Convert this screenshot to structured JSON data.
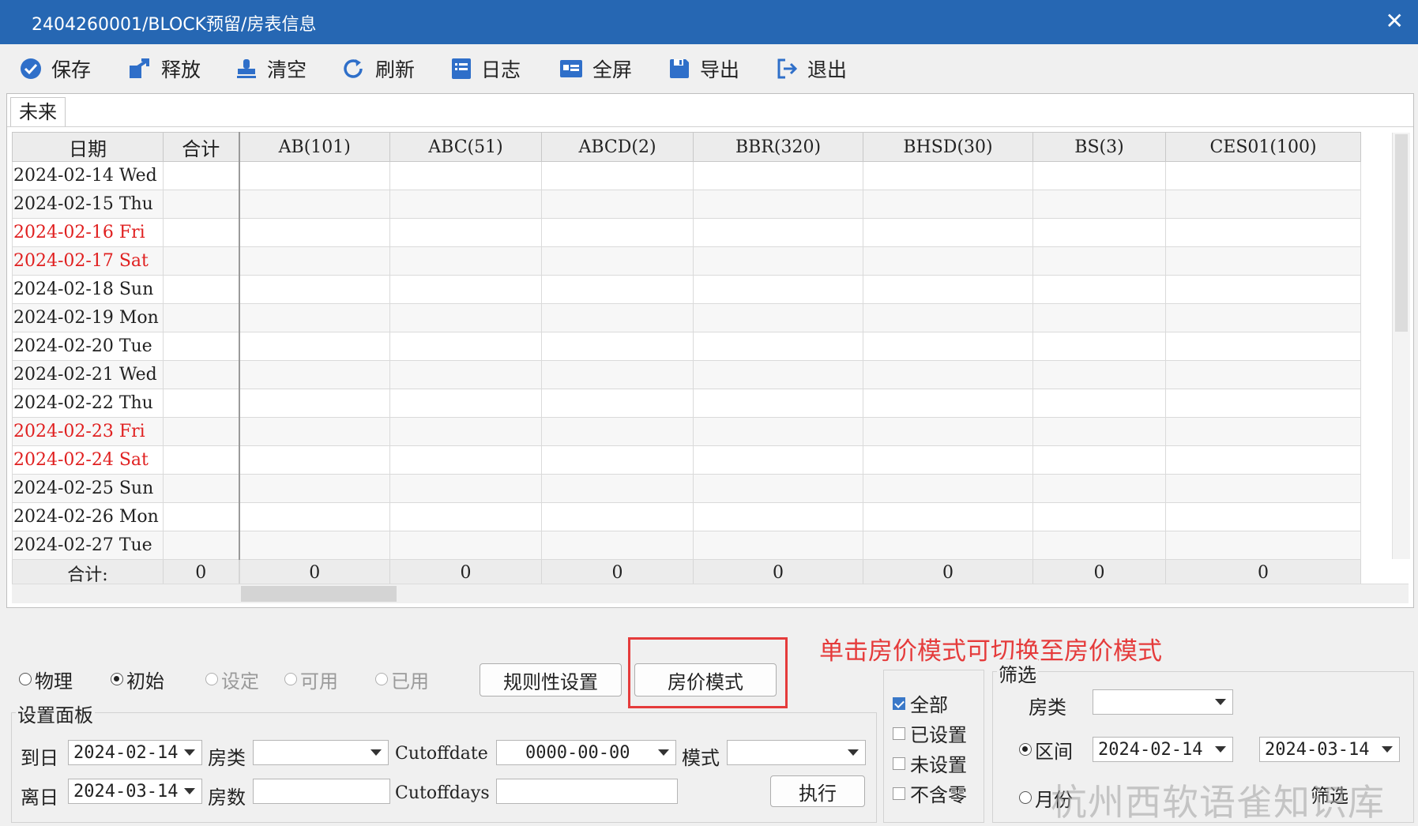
{
  "window": {
    "title": "2404260001/BLOCK预留/房表信息",
    "close_glyph": "✕"
  },
  "toolbar": [
    {
      "label": "保存",
      "icon": "check-circle-icon"
    },
    {
      "label": "释放",
      "icon": "release-icon"
    },
    {
      "label": "清空",
      "icon": "stamp-icon"
    },
    {
      "label": "刷新",
      "icon": "refresh-icon"
    },
    {
      "label": "日志",
      "icon": "log-icon"
    },
    {
      "label": "全屏",
      "icon": "fullscreen-icon"
    },
    {
      "label": "导出",
      "icon": "save-disk-icon"
    },
    {
      "label": "退出",
      "icon": "exit-icon"
    }
  ],
  "tabs": [
    "未来"
  ],
  "grid": {
    "headers": [
      "日期",
      "合计",
      "AB(101)",
      "ABC(51)",
      "ABCD(2)",
      "BBR(320)",
      "BHSD(30)",
      "BS(3)",
      "CES01(100)"
    ],
    "rows": [
      {
        "date": "2024-02-14 Wed",
        "weekend": false
      },
      {
        "date": "2024-02-15 Thu",
        "weekend": false
      },
      {
        "date": "2024-02-16 Fri",
        "weekend": true
      },
      {
        "date": "2024-02-17 Sat",
        "weekend": true
      },
      {
        "date": "2024-02-18 Sun",
        "weekend": false
      },
      {
        "date": "2024-02-19 Mon",
        "weekend": false
      },
      {
        "date": "2024-02-20 Tue",
        "weekend": false
      },
      {
        "date": "2024-02-21 Wed",
        "weekend": false
      },
      {
        "date": "2024-02-22 Thu",
        "weekend": false
      },
      {
        "date": "2024-02-23 Fri",
        "weekend": true
      },
      {
        "date": "2024-02-24 Sat",
        "weekend": true
      },
      {
        "date": "2024-02-25 Sun",
        "weekend": false
      },
      {
        "date": "2024-02-26 Mon",
        "weekend": false
      },
      {
        "date": "2024-02-27 Tue",
        "weekend": false
      }
    ],
    "total_label": "合计:",
    "totals": [
      "0",
      "0",
      "0",
      "0",
      "0",
      "0",
      "0",
      "0"
    ],
    "weekend_color": "#e02020"
  },
  "modes": [
    {
      "label": "物理",
      "selected": false,
      "enabled": true
    },
    {
      "label": "初始",
      "selected": true,
      "enabled": true
    },
    {
      "label": "设定",
      "selected": false,
      "enabled": false
    },
    {
      "label": "可用",
      "selected": false,
      "enabled": false
    },
    {
      "label": "已用",
      "selected": false,
      "enabled": false
    }
  ],
  "buttons": {
    "rules": "规则性设置",
    "price_mode": "房价模式",
    "execute": "执行",
    "filter": "筛选"
  },
  "annotation": "单击房价模式可切换至房价模式",
  "settings": {
    "group_label": "设置面板",
    "arrive_label": "到日",
    "arrive_value": "2024-02-14",
    "depart_label": "离日",
    "depart_value": "2024-03-14",
    "roomtype_label": "房类",
    "roomtype_value": "",
    "roomcount_label": "房数",
    "roomcount_value": "",
    "cutoffdate_label": "Cutoffdate",
    "cutoffdate_value": "0000-00-00",
    "cutoffdays_label": "Cutoffdays",
    "cutoffdays_value": "",
    "mode_label": "模式",
    "mode_value": ""
  },
  "checks": [
    {
      "label": "全部",
      "checked": true
    },
    {
      "label": "已设置",
      "checked": false
    },
    {
      "label": "未设置",
      "checked": false
    },
    {
      "label": "不含零",
      "checked": false
    }
  ],
  "filter": {
    "group_label": "筛选",
    "roomtype_label": "房类",
    "roomtype_value": "",
    "range_label": "区间",
    "range_selected": true,
    "range_from": "2024-02-14",
    "range_to": "2024-03-14",
    "month_label": "月份",
    "month_selected": false
  },
  "watermark": "杭州西软语雀知识库",
  "colors": {
    "titlebar": "#2667b3",
    "accent": "#3a78c8",
    "annotation": "#e53b3b"
  }
}
